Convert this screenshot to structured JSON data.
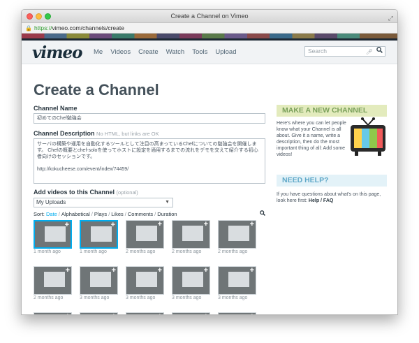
{
  "browser": {
    "title": "Create a Channel on Vimeo",
    "url_scheme": "https://",
    "url_rest": "vimeo.com/channels/create"
  },
  "header": {
    "logo": "vimeo",
    "nav": [
      "Me",
      "Videos",
      "Create",
      "Watch",
      "Tools",
      "Upload"
    ],
    "search_placeholder": "Search"
  },
  "page": {
    "title": "Create a Channel",
    "channel_name_label": "Channel Name",
    "channel_name_value": "初めてのChef勉強会",
    "description_label": "Channel Description",
    "description_hint": "No HTML, but links are OK",
    "description_value": "サーバの構築や運用を自動化するツールとして注目の高まっているChefについての勉強会を開催します。 Chefの概要とchef-soloを使ってホストに設定を適用するまでの流れをデモを交えて紹介する初心者向けのセッションです。\n\nhttp://kokucheese.com/event/index/74459/",
    "add_videos_label": "Add videos to this Channel",
    "add_videos_hint": "(optional)",
    "uploads_select": "My Uploads",
    "sort": {
      "prefix": "Sort:",
      "options": [
        "Date",
        "Alphabetical",
        "Plays",
        "Likes",
        "Comments",
        "Duration"
      ]
    },
    "thumbnails": [
      {
        "ago": "1 month ago",
        "selected": true
      },
      {
        "ago": "1 month ago",
        "selected": true
      },
      {
        "ago": "2 months ago",
        "selected": false
      },
      {
        "ago": "2 months ago",
        "selected": false
      },
      {
        "ago": "2 months ago",
        "selected": false
      },
      {
        "ago": "2 months ago",
        "selected": false
      },
      {
        "ago": "3 months ago",
        "selected": false
      },
      {
        "ago": "3 months ago",
        "selected": false
      },
      {
        "ago": "3 months ago",
        "selected": false
      },
      {
        "ago": "3 months ago",
        "selected": false
      },
      {
        "ago": "",
        "selected": false
      },
      {
        "ago": "",
        "selected": false
      },
      {
        "ago": "",
        "selected": false
      },
      {
        "ago": "",
        "selected": false
      },
      {
        "ago": "",
        "selected": false
      }
    ]
  },
  "sidebar": {
    "make_title": "MAKE A NEW CHANNEL",
    "make_text": "Here's where you can let people know what your Channel is all about. Give it a name, write a description, then do the most important thing of all: Add some videos!",
    "help_title": "NEED HELP?",
    "help_text": "If you have questions about what's on this page, look here first:",
    "help_link": "Help / FAQ"
  },
  "colors": {
    "accent_blue": "#00adef",
    "make_bg": "#e3ebbd",
    "help_bg": "#e3f2f8"
  }
}
